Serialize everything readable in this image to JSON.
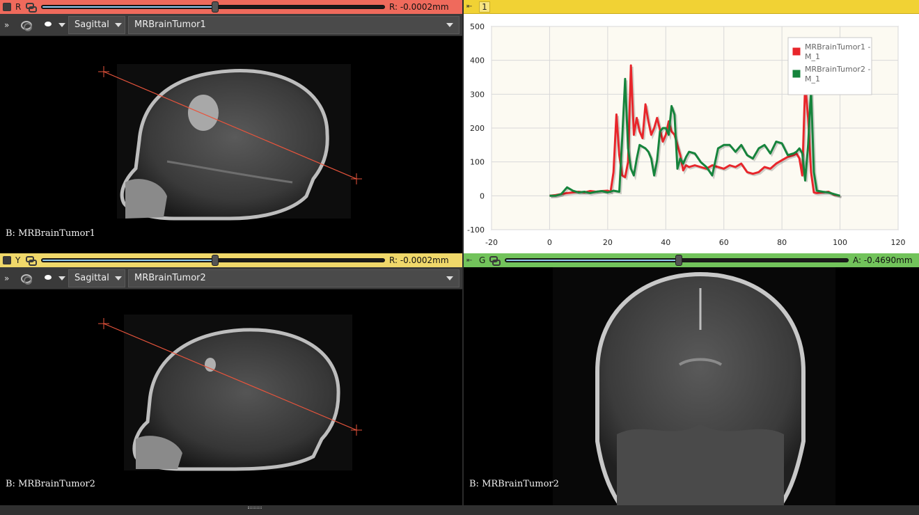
{
  "views": {
    "red": {
      "label": "R",
      "offset": "R: -0.0002mm",
      "slider_fraction": 0.5,
      "orientation": "Sagittal",
      "volume": "MRBrainTumor1",
      "annotation": "B: MRBrainTumor1"
    },
    "yellow": {
      "label": "Y",
      "offset": "R: -0.0002mm",
      "slider_fraction": 0.5,
      "orientation": "Sagittal",
      "volume": "MRBrainTumor2",
      "annotation": "B: MRBrainTumor2"
    },
    "green": {
      "label": "G",
      "offset": "A: -0.4690mm",
      "slider_fraction": 0.5,
      "annotation": "B: MRBrainTumor2"
    },
    "chart": {
      "label": "1"
    }
  },
  "icons": {
    "pin": "pin-icon",
    "link": "link-icon",
    "more": "chevron-double-right-icon",
    "visibility": "rings-icon",
    "label": "blob-icon"
  },
  "colors": {
    "red_view": "#ef6a5c",
    "yellow_view": "#f0d86a",
    "green_view": "#72c35b",
    "chart_bar": "#f1d234",
    "series1": "#e8262b",
    "series2": "#16843c"
  },
  "chart_data": {
    "type": "line",
    "title": "",
    "xlabel": "",
    "ylabel": "",
    "xlim": [
      -20,
      120
    ],
    "ylim": [
      -100,
      500
    ],
    "xticks": [
      "-20",
      "0",
      "20",
      "40",
      "60",
      "80",
      "100",
      "120"
    ],
    "yticks": [
      "-100",
      "0",
      "100",
      "200",
      "300",
      "400",
      "500"
    ],
    "grid": true,
    "legend": "top-right",
    "series": [
      {
        "name": "MRBrainTumor1 - M_1",
        "color": "#e8262b",
        "x": [
          0,
          2,
          4,
          6,
          8,
          10,
          12,
          14,
          16,
          18,
          20,
          21,
          22,
          23,
          24,
          25,
          26,
          27,
          28,
          29,
          30,
          31,
          32,
          33,
          34,
          35,
          36,
          37,
          38,
          39,
          40,
          41,
          42,
          43,
          44,
          45,
          46,
          47,
          48,
          50,
          52,
          54,
          56,
          58,
          60,
          62,
          64,
          66,
          68,
          70,
          72,
          74,
          76,
          78,
          80,
          82,
          84,
          85,
          86,
          87,
          88,
          89,
          90,
          91,
          92,
          94,
          96,
          98,
          100
        ],
        "y": [
          0,
          2,
          5,
          8,
          10,
          12,
          10,
          14,
          12,
          14,
          15,
          12,
          70,
          240,
          120,
          60,
          55,
          100,
          385,
          180,
          230,
          190,
          170,
          270,
          220,
          180,
          200,
          230,
          195,
          160,
          180,
          220,
          190,
          180,
          150,
          120,
          75,
          90,
          85,
          90,
          85,
          80,
          90,
          85,
          80,
          90,
          85,
          95,
          70,
          65,
          70,
          85,
          80,
          95,
          105,
          115,
          120,
          125,
          110,
          60,
          330,
          230,
          70,
          10,
          8,
          10,
          12,
          3,
          0
        ]
      },
      {
        "name": "MRBrainTumor2 - M_1",
        "color": "#16843c",
        "x": [
          0,
          2,
          4,
          6,
          8,
          10,
          12,
          14,
          16,
          18,
          20,
          22,
          24,
          25,
          26,
          27,
          28,
          29,
          30,
          31,
          32,
          33,
          34,
          35,
          36,
          37,
          38,
          39,
          40,
          41,
          42,
          43,
          44,
          45,
          46,
          47,
          48,
          50,
          52,
          54,
          56,
          58,
          60,
          62,
          64,
          66,
          68,
          70,
          72,
          74,
          76,
          78,
          80,
          82,
          84,
          85,
          86,
          87,
          88,
          89,
          90,
          91,
          92,
          94,
          96,
          98,
          100
        ],
        "y": [
          0,
          0,
          5,
          25,
          15,
          10,
          12,
          8,
          12,
          14,
          10,
          15,
          12,
          170,
          345,
          140,
          80,
          60,
          110,
          150,
          145,
          140,
          130,
          110,
          60,
          105,
          190,
          200,
          200,
          180,
          265,
          240,
          80,
          110,
          95,
          115,
          130,
          125,
          100,
          85,
          60,
          140,
          150,
          150,
          130,
          150,
          120,
          110,
          140,
          150,
          125,
          160,
          155,
          120,
          125,
          130,
          140,
          125,
          45,
          150,
          315,
          70,
          15,
          12,
          10,
          5,
          0
        ]
      }
    ]
  }
}
